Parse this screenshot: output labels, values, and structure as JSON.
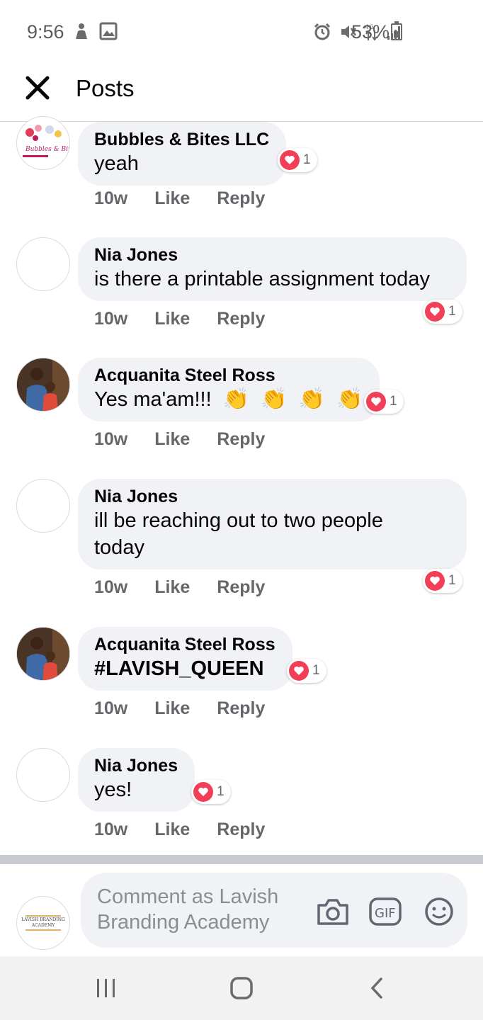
{
  "status_bar": {
    "time": "9:56",
    "battery": "53%"
  },
  "header": {
    "title": "Posts"
  },
  "comments": [
    {
      "author": "Bubbles & Bites LLC",
      "text": "yeah",
      "time": "10w",
      "like": "Like",
      "reply": "Reply",
      "reaction_count": "1"
    },
    {
      "author": "Nia Jones",
      "text": "is there a printable assignment today",
      "time": "10w",
      "like": "Like",
      "reply": "Reply",
      "reaction_count": "1"
    },
    {
      "author": "Acquanita Steel Ross",
      "text": "Yes ma'am!!!",
      "time": "10w",
      "like": "Like",
      "reply": "Reply",
      "reaction_count": "1"
    },
    {
      "author": "Nia Jones",
      "text_line1": "ill be reaching out to two people",
      "text_line2": "today",
      "time": "10w",
      "like": "Like",
      "reply": "Reply",
      "reaction_count": "1"
    },
    {
      "author": "Acquanita Steel Ross",
      "text": "#LAVISH_QUEEN",
      "time": "10w",
      "like": "Like",
      "reply": "Reply",
      "reaction_count": "1"
    },
    {
      "author": "Nia Jones",
      "text": "yes!",
      "time": "10w",
      "like": "Like",
      "reply": "Reply",
      "reaction_count": "1"
    }
  ],
  "composer": {
    "placeholder_line1": "Comment as Lavish",
    "placeholder_line2": "Branding Academy",
    "avatar_logo_line1": "LAVISH BRANDING",
    "avatar_logo_line2": "ACADEMY",
    "bubbles_logo_text": "Bubbles & Bites"
  },
  "colors": {
    "bubble_bg": "#f0f2f5",
    "meta_text": "#65676b",
    "love_red": "#f33e58",
    "divider": "#c9ccd1"
  },
  "icons": {
    "close": "close-icon",
    "camera": "camera-icon",
    "gif": "gif-icon",
    "emoji": "emoji-icon",
    "heart": "heart-icon",
    "clap": "clapping-hands-emoji"
  }
}
